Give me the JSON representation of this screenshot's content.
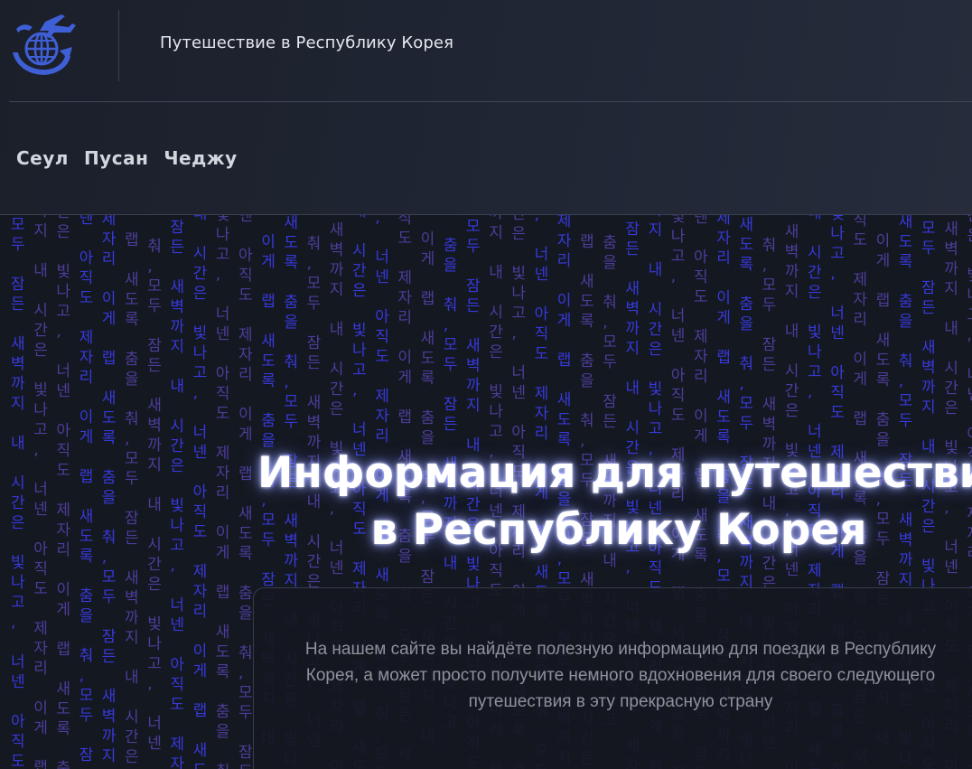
{
  "header": {
    "site_title": "Путешествие в Республику Корея",
    "logo_icon": "globe-airplane-icon"
  },
  "nav": {
    "items": [
      {
        "label": "Сеул"
      },
      {
        "label": "Пусан"
      },
      {
        "label": "Чеджу"
      }
    ]
  },
  "hero": {
    "title_line1": "Информация для путешествия",
    "title_line2": "в Республику Корея",
    "description": "На нашем сайте вы найдёте полезную информацию для поездки в Республику Корея, а может просто получите немного вдохновения для своего следующего путешествия в эту прекрасную страну",
    "rain_text": "모두 잠든 새벽까지 내 시간은 빛나고, 너넨 아직도 제자리 이게 랩 새도록 춤을 춰,",
    "colors": {
      "rain_blue": "#3b3df0",
      "rain_purple": "#7a5cff",
      "title_glow": "#8a90ff",
      "logo_blue": "#3f5fd6"
    }
  }
}
